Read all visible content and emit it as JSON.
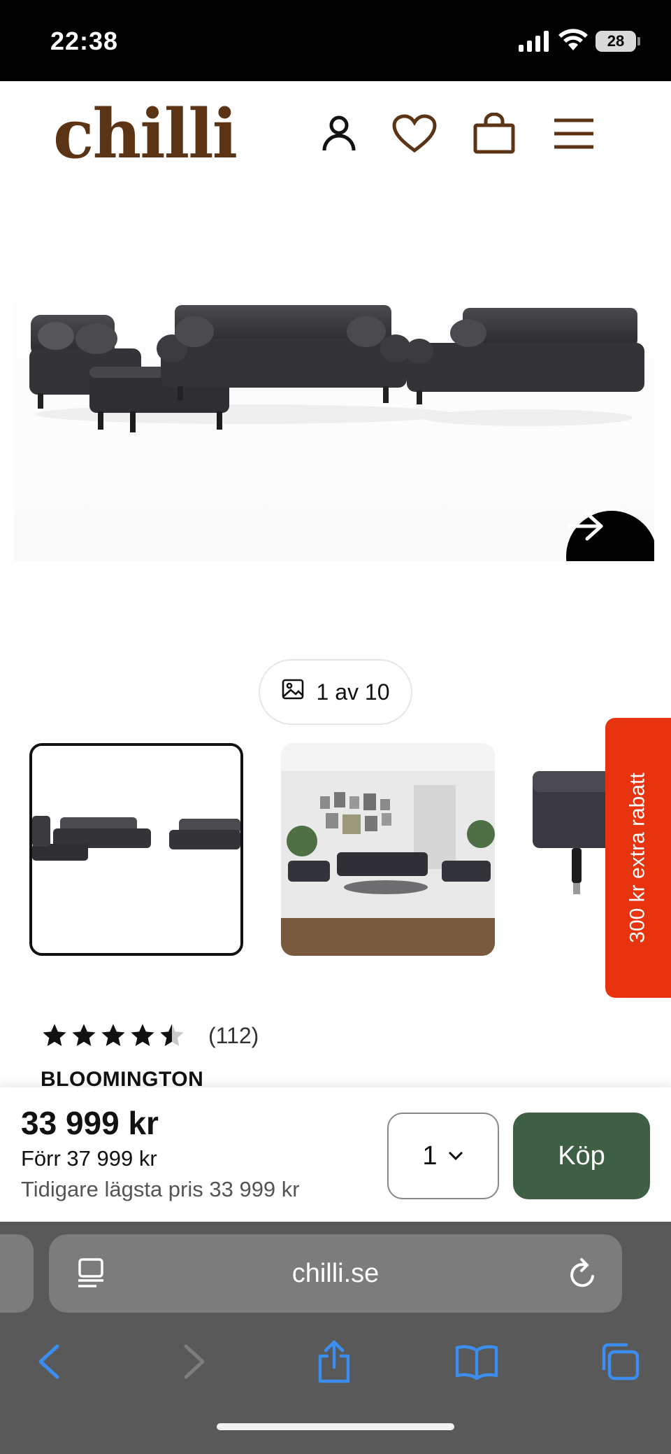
{
  "status_bar": {
    "time": "22:38",
    "battery": "28"
  },
  "header": {
    "logo": "chilli",
    "icons": [
      "user-icon",
      "heart-icon",
      "bag-icon",
      "menu-icon"
    ]
  },
  "gallery": {
    "counter": "1 av 10",
    "next_icon": "arrow-right-icon"
  },
  "promo": {
    "label": "300 kr extra rabatt",
    "color": "#e8330f"
  },
  "product": {
    "rating": 4.5,
    "rating_count": "(112)",
    "title": "BLOOMINGTON"
  },
  "pricing": {
    "price": "33 999 kr",
    "before": "Förr 37 999 kr",
    "lowest": "Tidigare lägsta pris 33 999 kr",
    "quantity": "1",
    "buy_label": "Köp",
    "buy_color": "#3f5f45"
  },
  "browser": {
    "url": "chilli.se"
  },
  "colors": {
    "brand": "#5b3416",
    "accent_red": "#e8330f",
    "buy_green": "#3f5f45"
  }
}
